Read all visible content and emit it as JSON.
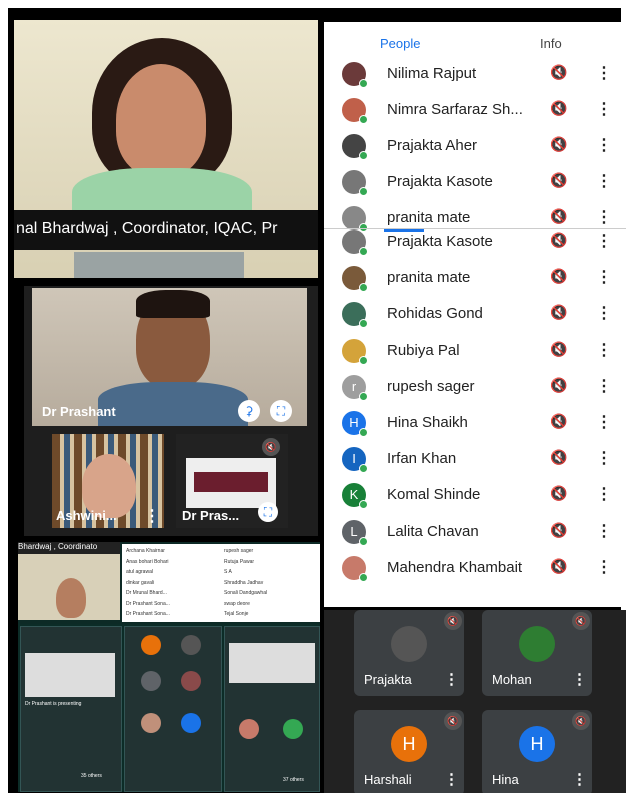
{
  "top_video": {
    "caption": "nal Bhardwaj , Coordinator, IQAC, Pr"
  },
  "people_panel": {
    "tabs": [
      "People",
      "Info"
    ],
    "list_top": [
      {
        "name": "Nilima Rajput",
        "avatar_color": "#6b3a3a"
      },
      {
        "name": "Nimra Sarfaraz Sh...",
        "avatar_color": "#c0604a"
      },
      {
        "name": "Prajakta Aher",
        "avatar_color": "#444444"
      },
      {
        "name": "Prajakta Kasote",
        "avatar_color": "#777777"
      },
      {
        "name": "pranita mate",
        "avatar_color": "#888888"
      }
    ],
    "list_bottom": [
      {
        "name": "Prajakta Kasote",
        "avatar_color": "#777777",
        "letter": ""
      },
      {
        "name": "pranita mate",
        "avatar_color": "#7a5a3a",
        "letter": ""
      },
      {
        "name": "Rohidas Gond",
        "avatar_color": "#3b6e5a",
        "letter": ""
      },
      {
        "name": "Rubiya Pal",
        "avatar_color": "#d4a33a",
        "letter": ""
      },
      {
        "name": "rupesh sager",
        "avatar_color": "#9e9e9e",
        "letter": "r"
      },
      {
        "name": "Hina Shaikh",
        "avatar_color": "#1a73e8",
        "letter": "H"
      },
      {
        "name": "Irfan Khan",
        "avatar_color": "#1565c0",
        "letter": "I"
      },
      {
        "name": "Komal Shinde",
        "avatar_color": "#188038",
        "letter": "K"
      },
      {
        "name": "Lalita Chavan",
        "avatar_color": "#5f6368",
        "letter": "L"
      },
      {
        "name": "Mahendra Khambait",
        "avatar_color": "#c77a6a",
        "letter": ""
      }
    ]
  },
  "mid_video": {
    "main_name": "Dr Prashant",
    "thumb1_name": "Ashwini...",
    "thumb2_name": "Dr Pras..."
  },
  "bottom_collage": {
    "caption": "Bhardwaj , Coordinato",
    "mini_list": [
      "Archana Khairnar",
      "Anas bohari Bohari",
      "atul agrawal",
      "dinkar gavali",
      "Dr Mrunal Bhard...",
      "Dr Prashant Sona...",
      "Dr Prashant Sona...",
      "rupesh sager",
      "Rutuja Pawar",
      "S A",
      "Shraddha Jadhav",
      "Sonali Dandgawhal",
      "swap deore",
      "Tejal Sonje"
    ],
    "presenting_label": "Dr Prashant is presenting",
    "others_a": "35 others",
    "others_b": "37 others"
  },
  "tiles": [
    {
      "name": "Prajakta",
      "letter": "",
      "color": "#555555"
    },
    {
      "name": "Mohan",
      "letter": "",
      "color": "#2e7d32"
    },
    {
      "name": "Harshali",
      "letter": "H",
      "color": "#e8710a"
    },
    {
      "name": "Hina",
      "letter": "H",
      "color": "#1a73e8"
    }
  ],
  "icons": {
    "mic_off": "mic-off-icon",
    "more": "more-vert-icon",
    "pin": "pin-icon",
    "fullscreen": "fullscreen-icon"
  }
}
